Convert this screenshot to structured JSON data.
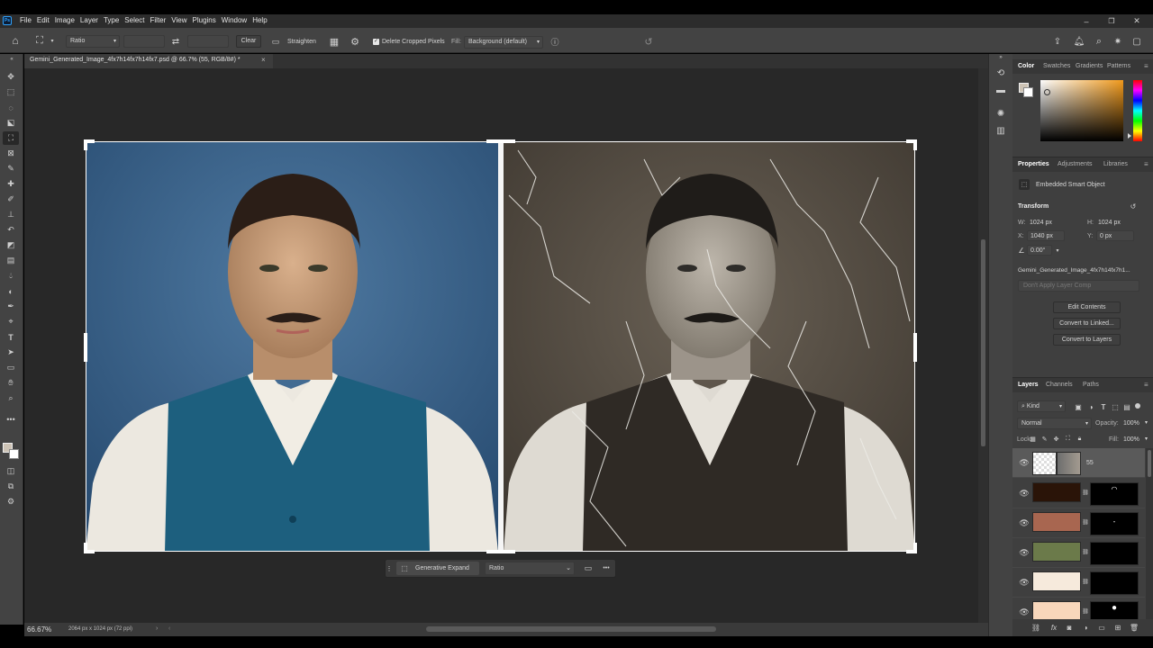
{
  "app": {
    "logo": "Ps"
  },
  "menu": [
    "File",
    "Edit",
    "Image",
    "Layer",
    "Type",
    "Select",
    "Filter",
    "View",
    "Plugins",
    "Window",
    "Help"
  ],
  "options": {
    "ratio": "Ratio",
    "clear": "Clear",
    "straighten": "Straighten",
    "delete_cropped": "Delete Cropped Pixels",
    "fill_label": "Fill:",
    "fill_value": "Background (default)"
  },
  "document_tab": {
    "title": "Gemini_Generated_Image_4fx7h14fx7h14fx7.psd @ 66.7% (55, RGB/8#) *",
    "close": "×"
  },
  "context_bar": {
    "label": "Generative Expand",
    "ratio": "Ratio",
    "more": "•••"
  },
  "status": {
    "zoom": "66.67%",
    "doc_info": "2064 px x 1024 px (72 ppi)"
  },
  "color_panel": {
    "tabs": [
      "Color",
      "Swatches",
      "Gradients",
      "Patterns"
    ],
    "hue_color": "#f19a1c"
  },
  "properties": {
    "tabs": [
      "Properties",
      "Adjustments",
      "Libraries"
    ],
    "type": "Embedded Smart Object",
    "transform": "Transform",
    "w_label": "W:",
    "w": "1024 px",
    "h_label": "H:",
    "h": "1024 px",
    "x_label": "X:",
    "x": "1040 px",
    "y_label": "Y:",
    "y": "0 px",
    "angle": "0.00°",
    "filename": "Gemini_Generated_Image_4fx7h14fx7h1...",
    "layer_comp": "Don't Apply Layer Comp",
    "edit_contents": "Edit Contents",
    "convert_linked": "Convert to Linked...",
    "convert_layers": "Convert to Layers"
  },
  "layers": {
    "tabs": [
      "Layers",
      "Channels",
      "Paths"
    ],
    "kind": "Kind",
    "blend": "Normal",
    "opacity_label": "Opacity:",
    "opacity": "100%",
    "lock_label": "Lock:",
    "fill_label": "Fill:",
    "fill": "100%",
    "items": [
      {
        "name": "55",
        "thumb": "#6b6b6b"
      },
      {
        "name": "",
        "thumb": "#2a1408"
      },
      {
        "name": "",
        "thumb": "#a86650"
      },
      {
        "name": "",
        "thumb": "#6b7a4a"
      },
      {
        "name": "",
        "thumb": "#f6eadc"
      },
      {
        "name": "",
        "thumb": "#f8d7bb"
      }
    ]
  }
}
